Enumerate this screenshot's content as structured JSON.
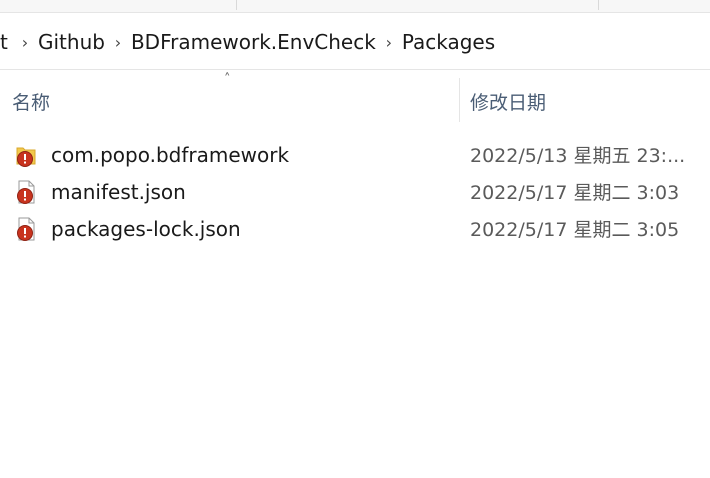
{
  "breadcrumb": {
    "leading_partial": "t",
    "items": [
      "Github",
      "BDFramework.EnvCheck",
      "Packages"
    ]
  },
  "columns": {
    "name": "名称",
    "date_modified": "修改日期"
  },
  "files": [
    {
      "name": "com.popo.bdframework",
      "date": "2022/5/13 星期五 23:...",
      "icon": "folder-shortcut-icon"
    },
    {
      "name": "manifest.json",
      "date": "2022/5/17 星期二 3:03",
      "icon": "json-file-icon"
    },
    {
      "name": "packages-lock.json",
      "date": "2022/5/17 星期二 3:05",
      "icon": "json-file-icon"
    }
  ],
  "colors": {
    "header_text": "#4a5d75",
    "date_text": "#5a5a5a",
    "badge_red": "#c8331e",
    "folder_yellow": "#f2c94c"
  }
}
